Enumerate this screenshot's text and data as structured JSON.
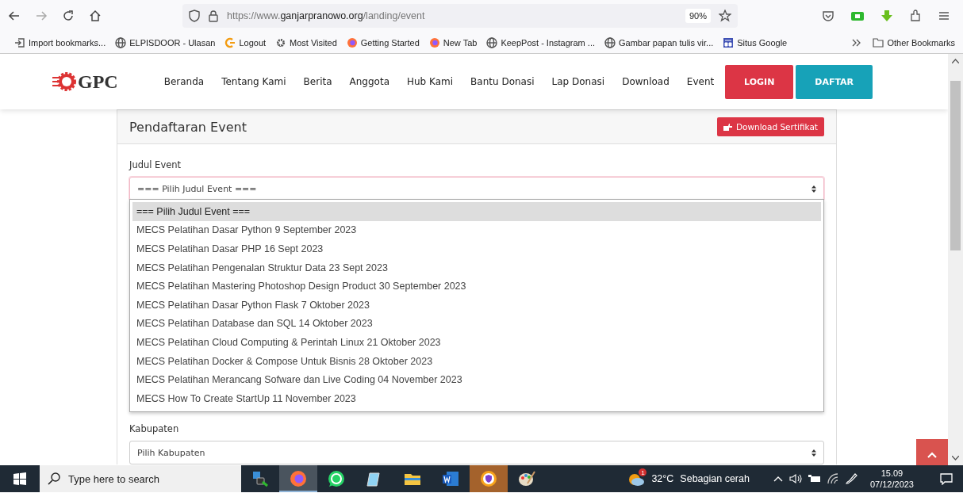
{
  "browser": {
    "url_prefix": "https://www.",
    "url_domain": "ganjarpranowo.org",
    "url_path": "/landing/event",
    "zoom": "90%",
    "bookmarks": [
      {
        "label": "Import bookmarks...",
        "kind": "import"
      },
      {
        "label": "ELPISDOOR - Ulasan",
        "kind": "globe"
      },
      {
        "label": "Logout",
        "kind": "logout"
      },
      {
        "label": "Most Visited",
        "kind": "gear"
      },
      {
        "label": "Getting Started",
        "kind": "firefox"
      },
      {
        "label": "New Tab",
        "kind": "firefox"
      },
      {
        "label": "KeepPost - Instagram ...",
        "kind": "globe"
      },
      {
        "label": "Gambar papan tulis vir...",
        "kind": "globe"
      },
      {
        "label": "Situs Google",
        "kind": "sites"
      }
    ],
    "other_bookmarks": "Other Bookmarks"
  },
  "navbar": {
    "logo": "GPC",
    "items": [
      "Beranda",
      "Tentang Kami",
      "Berita",
      "Anggota",
      "Hub Kami",
      "Bantu Donasi",
      "Lap Donasi",
      "Download",
      "Event"
    ],
    "buttons": [
      {
        "label": "LOGIN",
        "kind": "danger"
      },
      {
        "label": "DAFTAR",
        "kind": "info"
      }
    ]
  },
  "form": {
    "title": "Pendaftaran Event",
    "certificate_button": "Download Sertifikat",
    "event_field": {
      "label": "Judul Event",
      "value": "=== Pilih Judul Event ===",
      "expanded": true,
      "options": [
        {
          "label": "=== Pilih Judul Event ===",
          "selected": true
        },
        {
          "label": "MECS Pelatihan Dasar Python 9 September 2023",
          "selected": false
        },
        {
          "label": "MECS Pelatihan Dasar PHP 16 Sept 2023",
          "selected": false
        },
        {
          "label": "MECS Pelatihan Pengenalan Struktur Data 23 Sept 2023",
          "selected": false
        },
        {
          "label": "MECS Pelatihan Mastering Photoshop Design Product 30 September 2023",
          "selected": false
        },
        {
          "label": "MECS Pelatihan Dasar Python Flask 7 Oktober 2023",
          "selected": false
        },
        {
          "label": "MECS Pelatihan Database dan SQL 14 Oktober 2023",
          "selected": false
        },
        {
          "label": "MECS Pelatihan Cloud Computing & Perintah Linux 21 Oktober 2023",
          "selected": false
        },
        {
          "label": "MECS Pelatihan Docker & Compose Untuk Bisnis 28 Oktober 2023",
          "selected": false
        },
        {
          "label": "MECS Pelatihan Merancang Sofware dan Live Coding 04 November 2023",
          "selected": false
        },
        {
          "label": "MECS How To Create StartUp 11 November 2023",
          "selected": false
        }
      ]
    },
    "district_field": {
      "label": "Kabupaten",
      "value": "Pilih Kabupaten"
    }
  },
  "taskbar": {
    "search_placeholder": "Type here to search",
    "apps": [
      {
        "kind": "lock",
        "selected": false,
        "flashing": false
      },
      {
        "kind": "firefox",
        "selected": true,
        "flashing": false
      },
      {
        "kind": "whatsapp",
        "selected": false,
        "flashing": false
      },
      {
        "kind": "notepad",
        "selected": false,
        "flashing": false
      },
      {
        "kind": "folder",
        "selected": false,
        "flashing": false
      },
      {
        "kind": "word",
        "selected": false,
        "flashing": false
      },
      {
        "kind": "vpn",
        "selected": false,
        "flashing": true
      },
      {
        "kind": "paint",
        "selected": false,
        "flashing": false
      }
    ],
    "weather_badge": "1",
    "temperature": "32°C",
    "weather": "Sebagian cerah",
    "time": "15.09",
    "date": "07/12/2023"
  }
}
